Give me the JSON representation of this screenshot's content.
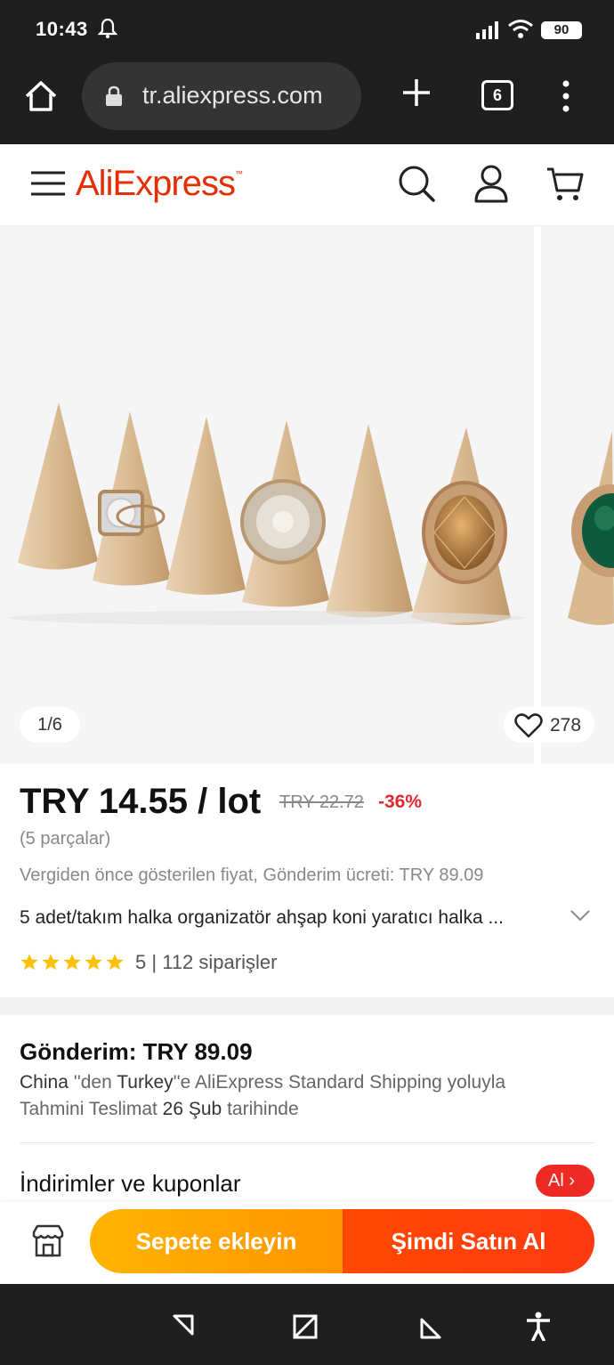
{
  "status_bar": {
    "time": "10:43",
    "battery": "90"
  },
  "browser": {
    "url": "tr.aliexpress.com",
    "tab_count": "6"
  },
  "site": {
    "logo": "AliExpress",
    "logo_tm": "™"
  },
  "gallery": {
    "counter": "1/6",
    "wishlist_count": "278"
  },
  "product": {
    "price": "TRY 14.55 / lot",
    "old_price": "TRY 22.72",
    "discount": "-36%",
    "pieces": "(5 parçalar)",
    "tax_note": "Vergiden önce gösterilen fiyat, Gönderim ücreti: TRY 89.09",
    "title": "5 adet/takım halka organizatör ahşap koni yaratıcı halka ...",
    "rating": "5",
    "rating_max": 5,
    "separator": "|",
    "orders": "112 siparişler"
  },
  "shipping": {
    "title": "Gönderim: TRY 89.09",
    "from": "China",
    "from_suffix": " ''den ",
    "to": "Turkey",
    "to_suffix": "''e AliExpress Standard Shipping yoluyla",
    "eta_prefix": "Tahmini Teslimat ",
    "eta_date": "26 Şub",
    "eta_suffix": " tarihinde"
  },
  "coupons": {
    "title": "İndirimler ve kuponlar",
    "badge": "Al"
  },
  "actions": {
    "add_to_cart": "Sepete ekleyin",
    "buy_now": "Şimdi Satın Al"
  },
  "colors": {
    "brand": "#e62e04",
    "cart_button": "#ffa200",
    "buy_button": "#ff4200",
    "star": "#ffc107"
  }
}
